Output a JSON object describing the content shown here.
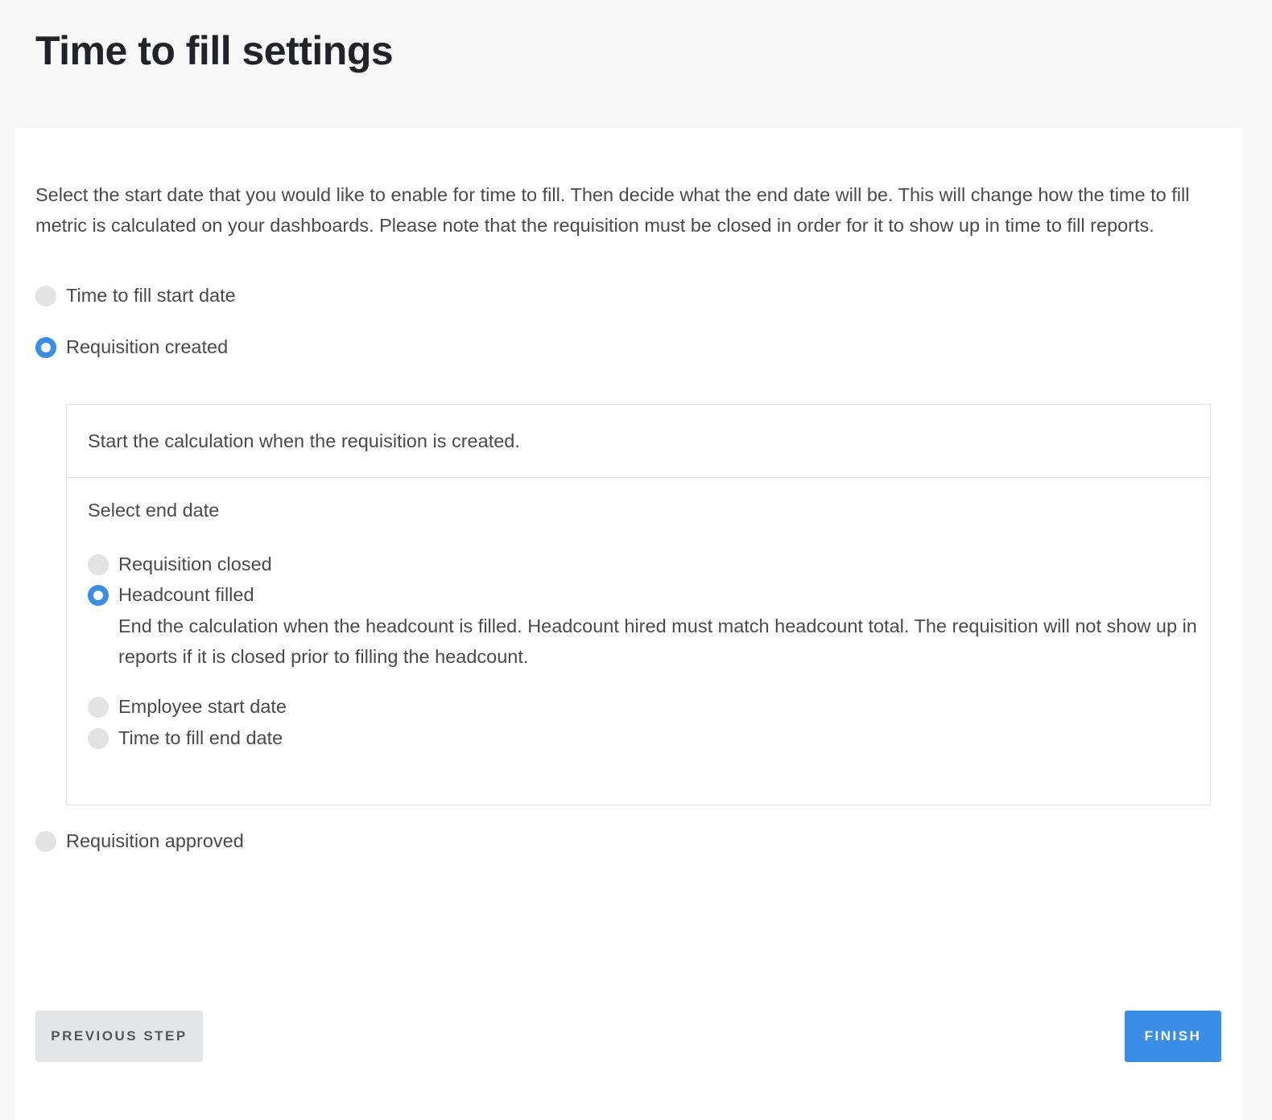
{
  "page": {
    "title": "Time to fill settings"
  },
  "intro": "Select the start date that you would like to enable for time to fill. Then decide what the end date will be. This will change how the time to fill metric is calculated on your dashboards. Please note that the requisition must be closed in order for it to show up in time to fill reports.",
  "start_options": [
    {
      "label": "Time to fill start date",
      "selected": false
    },
    {
      "label": "Requisition created",
      "selected": true
    },
    {
      "label": "Requisition approved",
      "selected": false
    }
  ],
  "selected_start": {
    "description": "Start the calculation when the requisition is created.",
    "end_date_title": "Select end date",
    "end_options": [
      {
        "label": "Requisition closed",
        "selected": false
      },
      {
        "label": "Headcount filled",
        "selected": true,
        "description": "End the calculation when the headcount is filled. Headcount hired must match headcount total. The requisition will not show up in reports if it is closed prior to filling the headcount."
      },
      {
        "label": "Employee start date",
        "selected": false
      },
      {
        "label": "Time to fill end date",
        "selected": false
      }
    ]
  },
  "buttons": {
    "previous": "PREVIOUS STEP",
    "finish": "FINISH"
  },
  "colors": {
    "accent": "#3a8ee6",
    "page_background": "#f8f8f8",
    "card_background": "#ffffff",
    "secondary_button": "#e4e5e6"
  }
}
